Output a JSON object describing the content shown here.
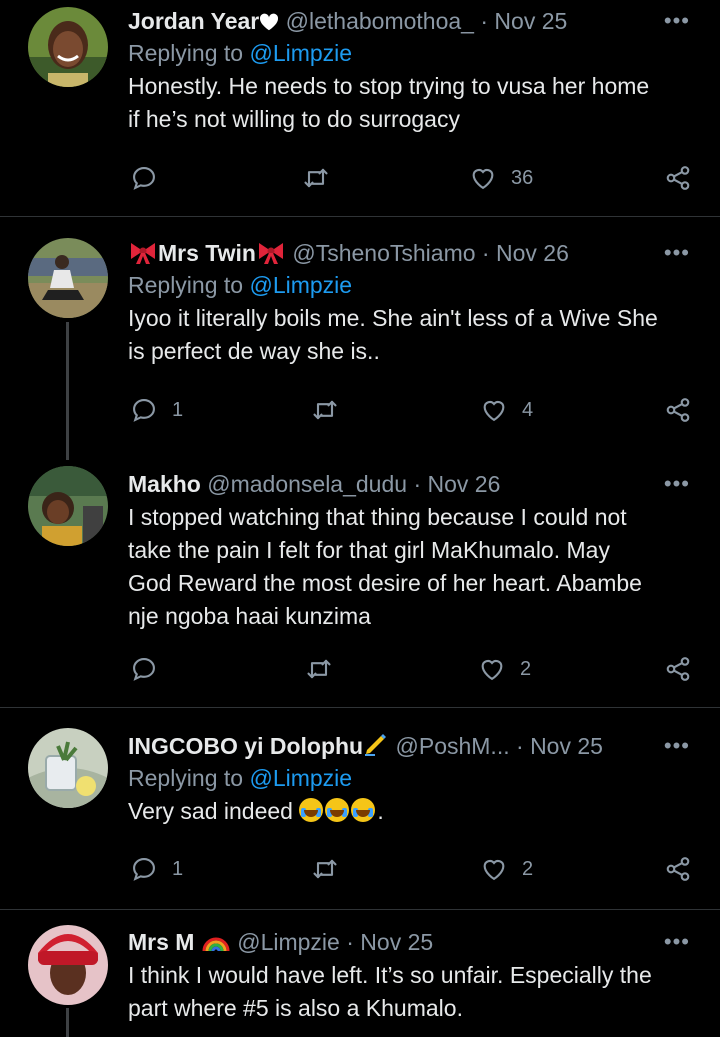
{
  "tweets": [
    {
      "name": "Jordan Year",
      "handle": "@lethabomothoa_",
      "sep": "·",
      "date": "Nov 25",
      "replying_prefix": "Replying to ",
      "replying_to": "@Limpzie",
      "body_lines": [
        "Honestly. He needs to stop trying to vusa her home",
        "if he’s not willing to do surrogacy"
      ],
      "counts": {
        "reply": "",
        "retweet": "",
        "like": "36"
      }
    },
    {
      "name": "Mrs Twin",
      "handle": "@TshenoTshiamo",
      "sep": "·",
      "date": "Nov 26",
      "replying_prefix": "Replying to ",
      "replying_to": "@Limpzie",
      "body_lines": [
        "Iyoo it literally boils me. She ain't less of a Wive She",
        "is perfect de way she is.."
      ],
      "counts": {
        "reply": "1",
        "retweet": "",
        "like": "4"
      }
    },
    {
      "name": "Makho",
      "handle": "@madonsela_dudu",
      "sep": "·",
      "date": "Nov 26",
      "body_lines": [
        "I stopped watching that thing because I could not",
        "take the pain I felt for that girl MaKhumalo. May",
        "God Reward the most desire of her heart. Abambe",
        "nje ngoba haai kunzima"
      ],
      "counts": {
        "reply": "",
        "retweet": "",
        "like": "2"
      }
    },
    {
      "name": "INGCOBO yi Dolophu",
      "handle": "@PoshM...",
      "sep": "·",
      "date": "Nov 25",
      "replying_prefix": "Replying to ",
      "replying_to": "@Limpzie",
      "body_text": "Very sad indeed ",
      "body_end": ".",
      "counts": {
        "reply": "1",
        "retweet": "",
        "like": "2"
      }
    },
    {
      "name": "Mrs M",
      "handle": "@Limpzie",
      "sep": "·",
      "date": "Nov 25",
      "body_lines": [
        "I think I would have left. It’s so unfair. Especially the",
        "part where #5 is also a Khumalo."
      ]
    }
  ],
  "more_label": "•••",
  "colors": {
    "background": "#000000",
    "text": "#e7e9ea",
    "muted": "#8b98a5",
    "link": "#1d9bf0",
    "divider": "#2f3336"
  }
}
